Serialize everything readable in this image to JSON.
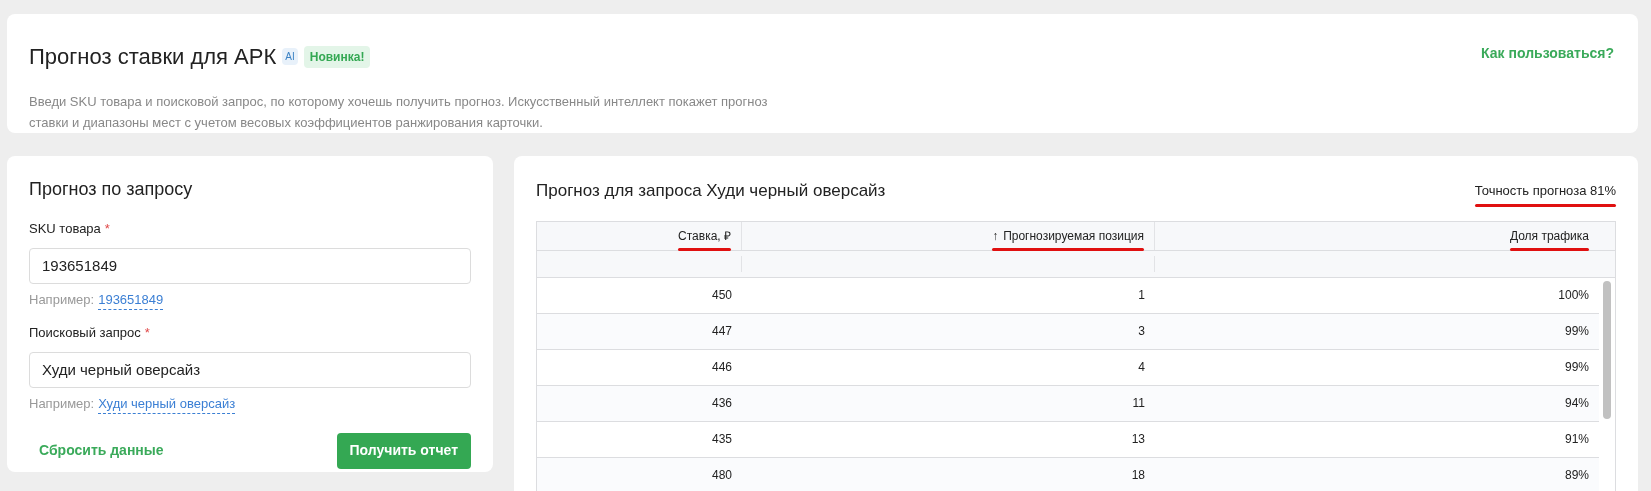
{
  "header": {
    "title": "Прогноз ставки для АРК",
    "ai_badge": "AI",
    "new_badge": "Новинка!",
    "description": "Введи SKU товара и поисковой запрос, по которому хочешь получить прогноз. Искусственный интеллект покажет прогноз ставки и диапазоны мест с учетом весовых коэффициентов ранжирования карточки.",
    "help_link": "Как пользоваться?"
  },
  "form": {
    "title": "Прогноз по запросу",
    "fields": [
      {
        "label": "SKU товара",
        "required_mark": "*",
        "value": "193651849",
        "example_label": "Например:",
        "example": "193651849"
      },
      {
        "label": "Поисковый запрос",
        "required_mark": "*",
        "value": "Худи черный оверсайз",
        "example_label": "Например:",
        "example": "Худи черный оверсайз"
      }
    ],
    "reset_button": "Сбросить данные",
    "submit_button": "Получить отчет"
  },
  "results": {
    "title": "Прогноз для запроса Худи черный оверсайз",
    "accuracy": {
      "text": "Точность прогноза 81%",
      "underlined": true
    },
    "table": {
      "columns": [
        {
          "label": "Ставка, ₽",
          "sorted": false,
          "underlined": true
        },
        {
          "label": "Прогнозируемая позиция",
          "sorted": true,
          "sort_icon": "↑",
          "underlined": true
        },
        {
          "label": "Доля трафика",
          "sorted": false,
          "underlined": true
        }
      ],
      "rows": [
        [
          "450",
          "1",
          "100%"
        ],
        [
          "447",
          "3",
          "99%"
        ],
        [
          "446",
          "4",
          "99%"
        ],
        [
          "436",
          "11",
          "94%"
        ],
        [
          "435",
          "13",
          "91%"
        ],
        [
          "480",
          "18",
          "89%"
        ]
      ]
    }
  }
}
